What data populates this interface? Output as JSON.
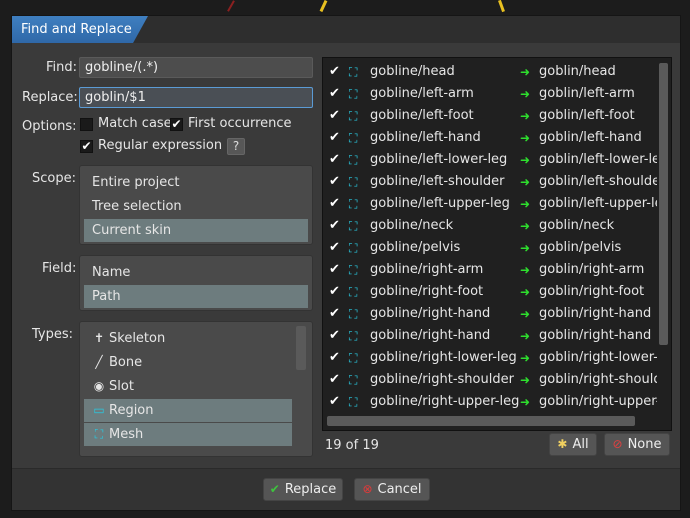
{
  "dialog": {
    "title": "Find and Replace"
  },
  "find": {
    "label": "Find:",
    "value": "gobline/(.*)"
  },
  "replace": {
    "label": "Replace:",
    "value": "goblin/$1"
  },
  "options": {
    "label": "Options:",
    "match_case": {
      "label": "Match case",
      "checked": false
    },
    "first_occurrence": {
      "label": "First occurrence",
      "checked": true
    },
    "regular_expression": {
      "label": "Regular expression",
      "checked": true
    },
    "help_label": "?"
  },
  "scope": {
    "label": "Scope:",
    "items": [
      "Entire project",
      "Tree selection",
      "Current skin"
    ],
    "selected": "Current skin"
  },
  "field": {
    "label": "Field:",
    "items": [
      "Name",
      "Path"
    ],
    "selected": "Path"
  },
  "types": {
    "label": "Types:",
    "items": [
      {
        "label": "Skeleton",
        "icon": "skeleton-icon",
        "selected": false
      },
      {
        "label": "Bone",
        "icon": "bone-icon",
        "selected": false
      },
      {
        "label": "Slot",
        "icon": "slot-icon",
        "selected": false
      },
      {
        "label": "Region",
        "icon": "region-icon",
        "selected": true
      },
      {
        "label": "Mesh",
        "icon": "mesh-icon",
        "selected": true
      }
    ]
  },
  "results": {
    "rows": [
      {
        "from": "gobline/head",
        "to": "goblin/head"
      },
      {
        "from": "gobline/left-arm",
        "to": "goblin/left-arm"
      },
      {
        "from": "gobline/left-foot",
        "to": "goblin/left-foot"
      },
      {
        "from": "gobline/left-hand",
        "to": "goblin/left-hand"
      },
      {
        "from": "gobline/left-lower-leg",
        "to": "goblin/left-lower-leg"
      },
      {
        "from": "gobline/left-shoulder",
        "to": "goblin/left-shoulder"
      },
      {
        "from": "gobline/left-upper-leg",
        "to": "goblin/left-upper-leg"
      },
      {
        "from": "gobline/neck",
        "to": "goblin/neck"
      },
      {
        "from": "gobline/pelvis",
        "to": "goblin/pelvis"
      },
      {
        "from": "gobline/right-arm",
        "to": "goblin/right-arm"
      },
      {
        "from": "gobline/right-foot",
        "to": "goblin/right-foot"
      },
      {
        "from": "gobline/right-hand",
        "to": "goblin/right-hand"
      },
      {
        "from": "gobline/right-hand",
        "to": "goblin/right-hand"
      },
      {
        "from": "gobline/right-lower-leg",
        "to": "goblin/right-lower-leg"
      },
      {
        "from": "gobline/right-shoulder",
        "to": "goblin/right-shoulder"
      },
      {
        "from": "gobline/right-upper-leg",
        "to": "goblin/right-upper-leg"
      }
    ],
    "count_text": "19 of 19",
    "all_label": "All",
    "none_label": "None"
  },
  "footer": {
    "replace_label": "Replace",
    "cancel_label": "Cancel"
  },
  "colors": {
    "accent": "#3473b5",
    "selection": "#6d7c7e",
    "arrow": "#2ee02e",
    "mesh": "#29c9e0"
  }
}
